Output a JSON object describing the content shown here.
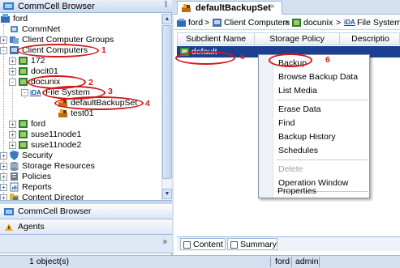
{
  "left_pane": {
    "title": "CommCell Browser",
    "pin_glyph": "ȉ",
    "tree": [
      {
        "label": "ford",
        "icon": "commcell-icon",
        "expander": ""
      },
      {
        "label": "CommNet",
        "icon": "commnet-icon",
        "expander": ""
      },
      {
        "label": "Client Computer Groups",
        "icon": "client-groups-icon",
        "expander": "+"
      },
      {
        "label": "Client Computers",
        "icon": "client-computers-icon",
        "expander": "-"
      },
      {
        "label": "172",
        "icon": "client-icon",
        "expander": "+"
      },
      {
        "label": "docit01",
        "icon": "client-icon",
        "expander": "+"
      },
      {
        "label": "docunix",
        "icon": "client-icon",
        "expander": "-"
      },
      {
        "label": "File System",
        "icon": "idataagent-icon",
        "icon_text": "iDA",
        "expander": "-"
      },
      {
        "label": "defaultBackupSet",
        "icon": "backupset-icon",
        "expander": ""
      },
      {
        "label": "test01",
        "icon": "backupset-icon",
        "expander": ""
      },
      {
        "label": "ford",
        "icon": "client-icon",
        "expander": "+"
      },
      {
        "label": "suse11node1",
        "icon": "client-icon",
        "expander": "+"
      },
      {
        "label": "suse11node2",
        "icon": "client-icon",
        "expander": "+"
      },
      {
        "label": "Security",
        "icon": "security-icon",
        "expander": "+"
      },
      {
        "label": "Storage Resources",
        "icon": "storage-icon",
        "expander": "+"
      },
      {
        "label": "Policies",
        "icon": "policies-icon",
        "expander": "+"
      },
      {
        "label": "Reports",
        "icon": "reports-icon",
        "expander": "+"
      },
      {
        "label": "Content Director",
        "icon": "content-director-icon",
        "expander": "+"
      }
    ],
    "nav_buttons": [
      "CommCell Browser",
      "Agents"
    ],
    "bottom_chevron": "»"
  },
  "right_pane": {
    "tab_label": "defaultBackupSet",
    "tab_close": "×",
    "breadcrumb": [
      "ford",
      "Client Computers",
      "docunix",
      "File System"
    ],
    "breadcrumb_sep": ">",
    "columns": [
      "Subclient Name",
      "Storage Policy",
      "Descriptio"
    ],
    "rows": [
      {
        "name": "default"
      }
    ],
    "bottom_tabs": [
      "Content",
      "Summary"
    ]
  },
  "context_menu": {
    "items": [
      {
        "label": "Backup",
        "disabled": false
      },
      {
        "label": "Browse Backup Data",
        "disabled": false
      },
      {
        "label": "List Media",
        "disabled": false
      },
      {
        "label": "Erase Data",
        "disabled": false
      },
      {
        "label": "Find",
        "disabled": false
      },
      {
        "label": "Backup History",
        "disabled": false
      },
      {
        "label": "Schedules",
        "disabled": false
      },
      {
        "label": "Delete",
        "disabled": true
      },
      {
        "label": "Operation Window",
        "disabled": false
      },
      {
        "label": "Properties",
        "disabled": false
      }
    ]
  },
  "status_bar": {
    "objects": "1 object(s)",
    "host": "ford",
    "user": "admin"
  },
  "annotations": [
    "1",
    "2",
    "3",
    "4",
    "5",
    "6"
  ],
  "colors": {
    "annotation": "#d11b1b",
    "selection": "#1c3f8f",
    "chrome": "#d4dff0",
    "border": "#9fb6d8"
  }
}
